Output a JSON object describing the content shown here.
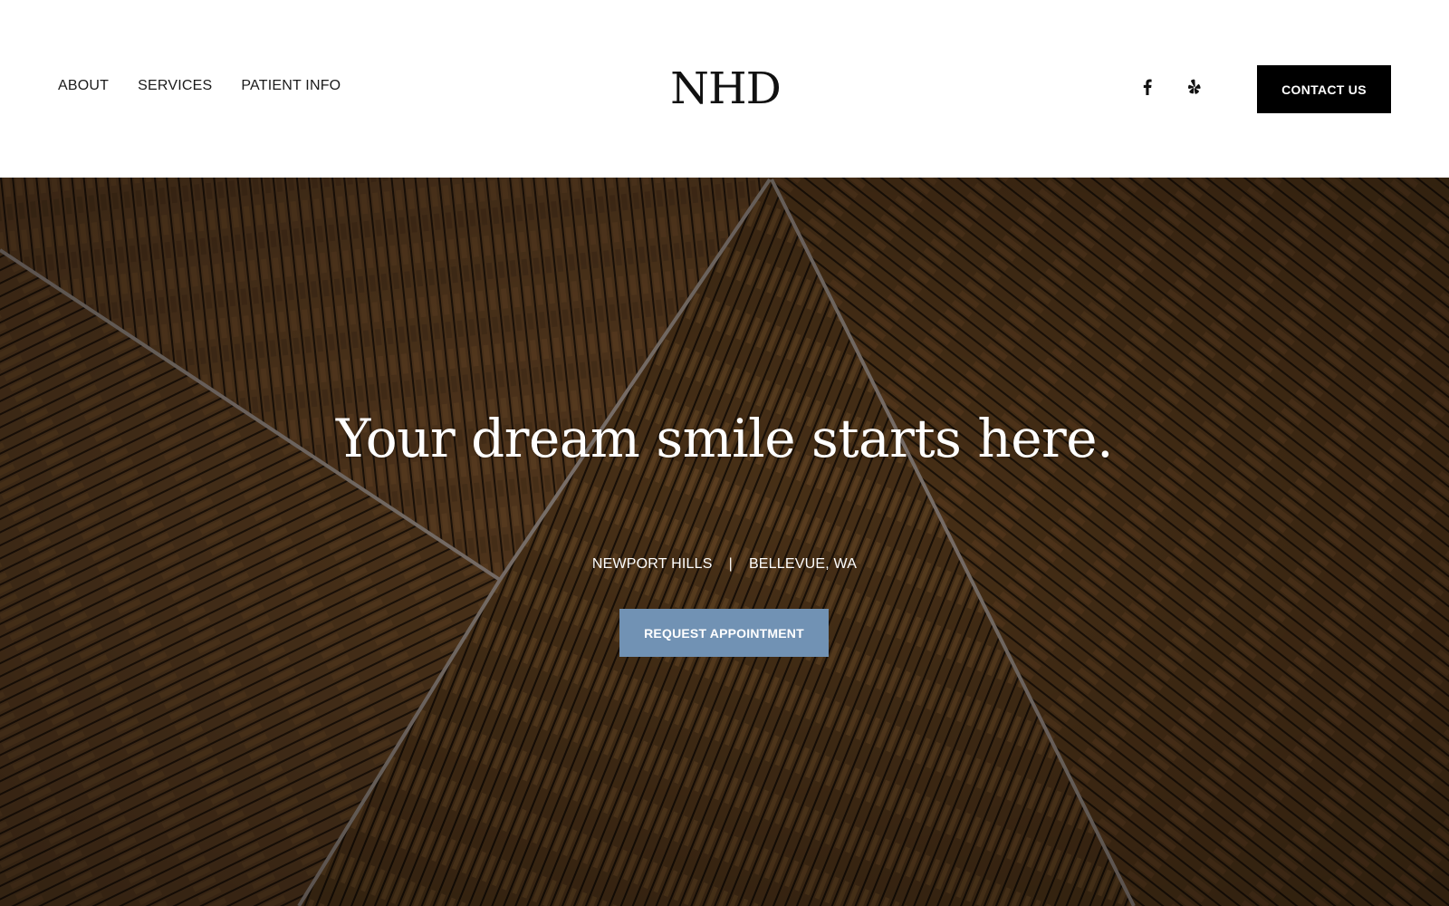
{
  "header": {
    "nav": [
      {
        "label": "ABOUT"
      },
      {
        "label": "SERVICES"
      },
      {
        "label": "PATIENT INFO"
      }
    ],
    "logo": "NHD",
    "social": [
      {
        "icon": "facebook-icon"
      },
      {
        "icon": "yelp-icon"
      }
    ],
    "contact_label": "CONTACT US"
  },
  "hero": {
    "title": "Your dream smile starts here.",
    "location_left": "NEWPORT HILLS",
    "separator": "|",
    "location_right": "BELLEVUE, WA",
    "cta_label": "REQUEST APPOINTMENT",
    "background": "wood slat panels",
    "colors": {
      "wood_dark": "#3a2614",
      "wood_mid": "#5a3c20",
      "wood_light": "#7a5530",
      "seam": "#8a7f78",
      "cta": "#7192b4"
    }
  }
}
